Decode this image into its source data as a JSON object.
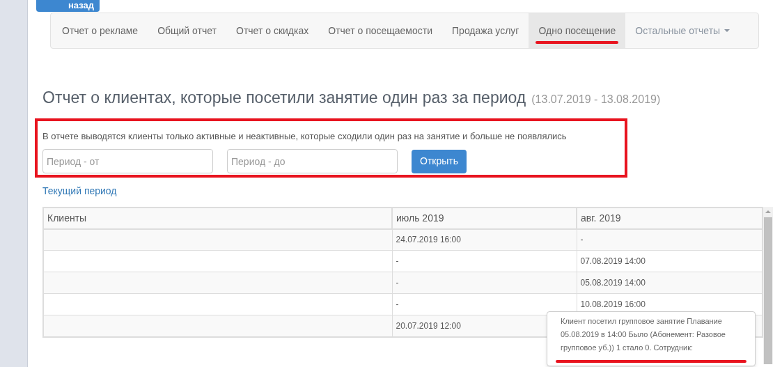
{
  "back_button": "назад",
  "nav": [
    {
      "label": "Отчет о рекламе",
      "selected": false,
      "kind": "link"
    },
    {
      "label": "Общий отчет",
      "selected": false,
      "kind": "link"
    },
    {
      "label": "Отчет о скидках",
      "selected": false,
      "kind": "link"
    },
    {
      "label": "Отчет о посещаемости",
      "selected": false,
      "kind": "link"
    },
    {
      "label": "Продажа услуг",
      "selected": false,
      "kind": "link"
    },
    {
      "label": "Одно посещение",
      "selected": true,
      "kind": "link"
    },
    {
      "label": "Остальные отчеты",
      "selected": false,
      "kind": "dropdown"
    }
  ],
  "title": "Отчет о клиентах, которые посетили занятие один раз за период",
  "period": "(13.07.2019 - 13.08.2019)",
  "filter": {
    "description": "В отчете выводятся клиенты только активные и неактивные, которые сходили один раз на занятие и больше не появлялись",
    "from": {
      "placeholder": "Период - от"
    },
    "to": {
      "placeholder": "Период - до"
    },
    "submit": "Открыть"
  },
  "current_period_link": "Текущий период",
  "table": {
    "columns": [
      "Клиенты",
      "июль 2019",
      "авг. 2019"
    ],
    "rows": [
      [
        "",
        "24.07.2019 16:00",
        "-"
      ],
      [
        "",
        "-",
        "07.08.2019 14:00"
      ],
      [
        "",
        "-",
        "05.08.2019 14:00"
      ],
      [
        "",
        "-",
        "10.08.2019 16:00"
      ],
      [
        "",
        "20.07.2019 12:00",
        ""
      ]
    ]
  },
  "tooltip": "Клиент посетил групповое занятие Плавание 05.08.2019 в 14:00 Было (Абонемент: Разовое групповое уб.)) 1 стало 0. Сотрудник:"
}
